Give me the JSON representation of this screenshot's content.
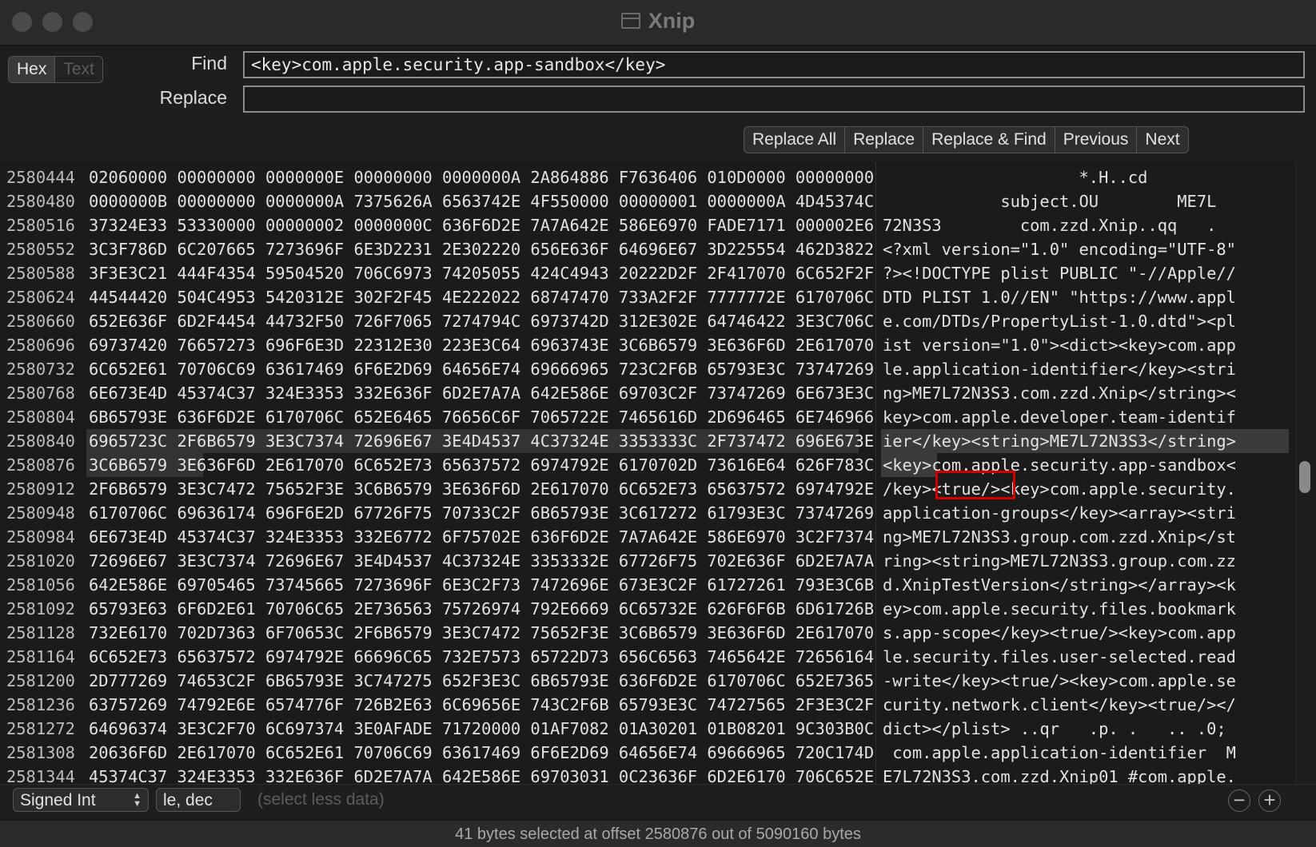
{
  "window": {
    "title": "Xnip",
    "title_icon": "window-icon"
  },
  "mode_toggle": {
    "hex_label": "Hex",
    "text_label": "Text",
    "selected": "Hex"
  },
  "find": {
    "label": "Find",
    "value": "<key>com.apple.security.app-sandbox</key>"
  },
  "replace": {
    "label": "Replace",
    "value": ""
  },
  "buttons": {
    "replace_all": "Replace All",
    "replace": "Replace",
    "replace_find": "Replace & Find",
    "previous": "Previous",
    "next": "Next"
  },
  "hex_rows": [
    {
      "offset": "2580444",
      "hex": "02060000 00000000 0000000E 00000000 0000000A 2A864886 F7636406 010D0000 00000000",
      "text": "                    *.H..cd"
    },
    {
      "offset": "2580480",
      "hex": "0000000B 00000000 0000000A 7375626A 6563742E 4F550000 00000001 0000000A 4D45374C",
      "text": "            subject.OU        ME7L"
    },
    {
      "offset": "2580516",
      "hex": "37324E33 53330000 00000002 0000000C 636F6D2E 7A7A642E 586E6970 FADE7171 000002E6",
      "text": "72N3S3        com.zzd.Xnip..qq   ."
    },
    {
      "offset": "2580552",
      "hex": "3C3F786D 6C207665 7273696F 6E3D2231 2E302220 656E636F 64696E67 3D225554 462D3822",
      "text": "<?xml version=\"1.0\" encoding=\"UTF-8\""
    },
    {
      "offset": "2580588",
      "hex": "3F3E3C21 444F4354 59504520 706C6973 74205055 424C4943 20222D2F 2F417070 6C652F2F",
      "text": "?><!DOCTYPE plist PUBLIC \"-//Apple//"
    },
    {
      "offset": "2580624",
      "hex": "44544420 504C4953 5420312E 302F2F45 4E222022 68747470 733A2F2F 7777772E 6170706C",
      "text": "DTD PLIST 1.0//EN\" \"https://www.appl"
    },
    {
      "offset": "2580660",
      "hex": "652E636F 6D2F4454 44732F50 726F7065 7274794C 6973742D 312E302E 64746422 3E3C706C",
      "text": "e.com/DTDs/PropertyList-1.0.dtd\"><pl"
    },
    {
      "offset": "2580696",
      "hex": "69737420 76657273 696F6E3D 22312E30 223E3C64 6963743E 3C6B6579 3E636F6D 2E617070",
      "text": "ist version=\"1.0\"><dict><key>com.app"
    },
    {
      "offset": "2580732",
      "hex": "6C652E61 70706C69 63617469 6F6E2D69 64656E74 69666965 723C2F6B 65793E3C 73747269",
      "text": "le.application-identifier</key><stri"
    },
    {
      "offset": "2580768",
      "hex": "6E673E4D 45374C37 324E3353 332E636F 6D2E7A7A 642E586E 69703C2F 73747269 6E673E3C",
      "text": "ng>ME7L72N3S3.com.zzd.Xnip</string><"
    },
    {
      "offset": "2580804",
      "hex": "6B65793E 636F6D2E 6170706C 652E6465 76656C6F 7065722E 7465616D 2D696465 6E746966",
      "text": "key>com.apple.developer.team-identif"
    },
    {
      "offset": "2580840",
      "hex": "6965723C 2F6B6579 3E3C7374 72696E67 3E4D4537 4C37324E 3353333C 2F737472 696E673E",
      "text": "ier</key><string>ME7L72N3S3</string>"
    },
    {
      "offset": "2580876",
      "hex": "3C6B6579 3E636F6D 2E617070 6C652E73 65637572 6974792E 6170702D 73616E64 626F783C",
      "text": "<key>com.apple.security.app-sandbox<"
    },
    {
      "offset": "2580912",
      "hex": "2F6B6579 3E3C7472 75652F3E 3C6B6579 3E636F6D 2E617070 6C652E73 65637572 6974792E",
      "text": "/key><true/><key>com.apple.security."
    },
    {
      "offset": "2580948",
      "hex": "6170706C 69636174 696F6E2D 67726F75 70733C2F 6B65793E 3C617272 61793E3C 73747269",
      "text": "application-groups</key><array><stri"
    },
    {
      "offset": "2580984",
      "hex": "6E673E4D 45374C37 324E3353 332E6772 6F75702E 636F6D2E 7A7A642E 586E6970 3C2F7374",
      "text": "ng>ME7L72N3S3.group.com.zzd.Xnip</st"
    },
    {
      "offset": "2581020",
      "hex": "72696E67 3E3C7374 72696E67 3E4D4537 4C37324E 3353332E 67726F75 702E636F 6D2E7A7A",
      "text": "ring><string>ME7L72N3S3.group.com.zz"
    },
    {
      "offset": "2581056",
      "hex": "642E586E 69705465 73745665 7273696F 6E3C2F73 7472696E 673E3C2F 61727261 793E3C6B",
      "text": "d.XnipTestVersion</string></array><k"
    },
    {
      "offset": "2581092",
      "hex": "65793E63 6F6D2E61 70706C65 2E736563 75726974 792E6669 6C65732E 626F6F6B 6D61726B",
      "text": "ey>com.apple.security.files.bookmark"
    },
    {
      "offset": "2581128",
      "hex": "732E6170 702D7363 6F70653C 2F6B6579 3E3C7472 75652F3E 3C6B6579 3E636F6D 2E617070",
      "text": "s.app-scope</key><true/><key>com.app"
    },
    {
      "offset": "2581164",
      "hex": "6C652E73 65637572 6974792E 66696C65 732E7573 65722D73 656C6563 7465642E 72656164",
      "text": "le.security.files.user-selected.read"
    },
    {
      "offset": "2581200",
      "hex": "2D777269 74653C2F 6B65793E 3C747275 652F3E3C 6B65793E 636F6D2E 6170706C 652E7365",
      "text": "-write</key><true/><key>com.apple.se"
    },
    {
      "offset": "2581236",
      "hex": "63757269 74792E6E 6574776F 726B2E63 6C69656E 743C2F6B 65793E3C 74727565 2F3E3C2F",
      "text": "curity.network.client</key><true/></"
    },
    {
      "offset": "2581272",
      "hex": "64696374 3E3C2F70 6C697374 3E0AFADE 71720000 01AF7082 01A30201 01B08201 9C303B0C",
      "text": "dict></plist> ..qr   .p. .   .. .0;"
    },
    {
      "offset": "2581308",
      "hex": "20636F6D 2E617070 6C652E61 70706C69 63617469 6F6E2D69 64656E74 69666965 720C174D",
      "text": " com.apple.application-identifier  M"
    },
    {
      "offset": "2581344",
      "hex": "45374C37 324E3353 332E636F 6D2E7A7A 642E586E 69703031 0C23636F 6D2E6170 706C652E",
      "text": "E7L72N3S3.com.zzd.Xnip01 #com.apple."
    }
  ],
  "inspector": {
    "type_value": "Signed Int",
    "format_value": "le, dec",
    "hint": "(select less data)",
    "minus": "−",
    "plus": "+"
  },
  "status": {
    "text": "41 bytes selected at offset 2580876 out of 5090160 bytes"
  },
  "colors": {
    "selection": "#333333",
    "highlight_box": "#d40000",
    "background": "#1b1b1b"
  }
}
